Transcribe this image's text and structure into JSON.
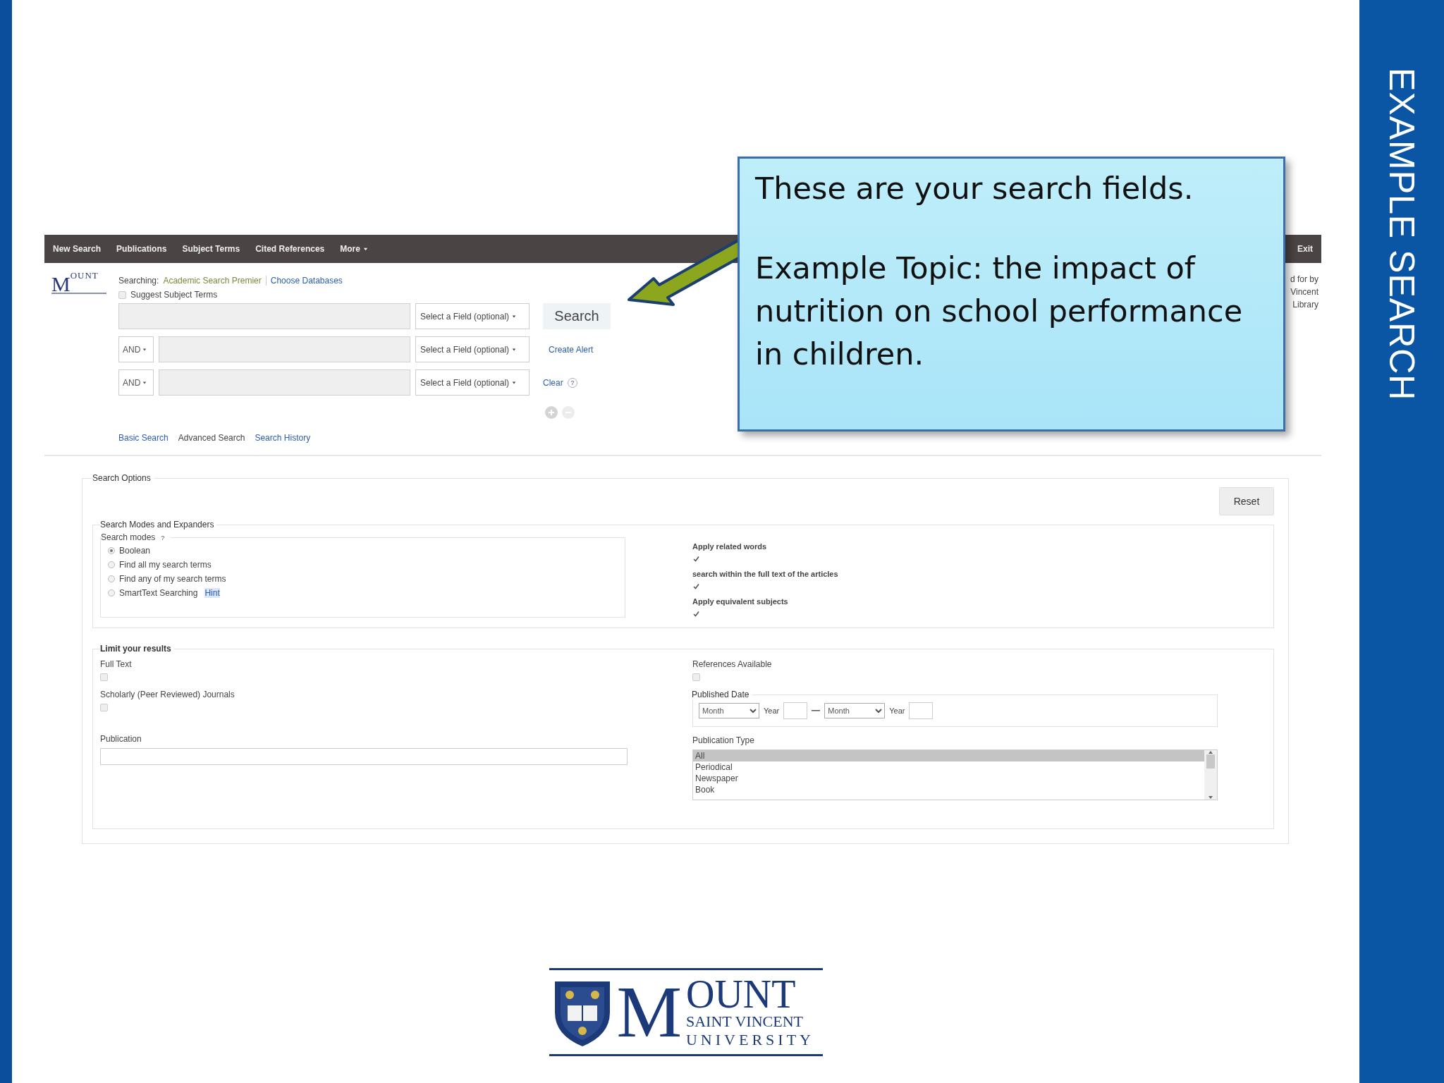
{
  "side_title": "EXAMPLE SEARCH",
  "nav": {
    "items": [
      {
        "label": "New Search",
        "dropdown": false
      },
      {
        "label": "Publications",
        "dropdown": false
      },
      {
        "label": "Subject Terms",
        "dropdown": false
      },
      {
        "label": "Cited References",
        "dropdown": false
      },
      {
        "label": "More",
        "dropdown": true
      }
    ],
    "exit": "Exit"
  },
  "header_logo": {
    "initial": "M",
    "rest": "OUNT"
  },
  "searching": {
    "label": "Searching:",
    "database": "Academic Search Premier",
    "link": "Choose Databases"
  },
  "suggest": {
    "label": "Suggest Subject Terms",
    "checked": false
  },
  "search_rows": [
    {
      "field": "Select a Field (optional)"
    },
    {
      "operator": "AND",
      "field": "Select a Field (optional)"
    },
    {
      "operator": "AND",
      "field": "Select a Field (optional)"
    }
  ],
  "search_button": "Search",
  "create_alert": "Create Alert",
  "clear": "Clear",
  "clear_help": "?",
  "search_links": [
    {
      "label": "Basic Search",
      "kind": "link"
    },
    {
      "label": "Advanced Search",
      "kind": "current"
    },
    {
      "label": "Search History",
      "kind": "link"
    }
  ],
  "side_note": [
    "d for by",
    "Vincent",
    "Library"
  ],
  "options": {
    "title": "Search Options",
    "reset": "Reset",
    "modes_section": {
      "title": "Search Modes and Expanders",
      "modes_label": "Search modes",
      "help": "?",
      "modes": [
        {
          "label": "Boolean",
          "selected": true
        },
        {
          "label": "Find all my search terms",
          "selected": false
        },
        {
          "label": "Find any of my search terms",
          "selected": false
        },
        {
          "label": "SmartText Searching",
          "selected": false,
          "hint": "Hint"
        }
      ],
      "expanders": [
        {
          "label": "Apply related words",
          "checked": true
        },
        {
          "label": "search within the full text of the articles",
          "checked": true
        },
        {
          "label": "Apply equivalent subjects",
          "checked": true
        }
      ]
    },
    "limits": {
      "title": "Limit your results",
      "left": [
        {
          "label": "Full Text",
          "checked": false
        },
        {
          "label": "Scholarly (Peer Reviewed) Journals",
          "checked": false
        }
      ],
      "publication": "Publication",
      "references": {
        "label": "References Available",
        "checked": false
      },
      "published_date": {
        "label": "Published Date",
        "from_month": "Month",
        "from_year": "Year",
        "to_month": "Month",
        "to_year": "Year"
      },
      "publication_type": {
        "label": "Publication Type",
        "options": [
          {
            "label": "All",
            "selected": true
          },
          {
            "label": "Periodical",
            "selected": false
          },
          {
            "label": "Newspaper",
            "selected": false
          },
          {
            "label": "Book",
            "selected": false
          }
        ]
      }
    }
  },
  "callout": [
    "These are your search fields.",
    "Example Topic: the impact of nutrition on school performance in children."
  ],
  "logo": {
    "initial": "M",
    "rest": "OUNT",
    "line2": "SAINT VINCENT",
    "line3": "UNIVERSITY"
  }
}
